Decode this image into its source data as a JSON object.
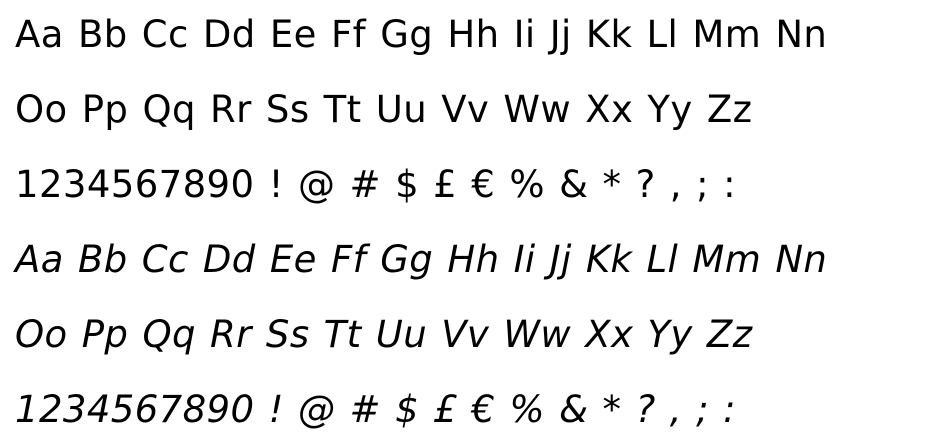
{
  "specimen": {
    "regular": {
      "line1": "Aa Bb Cc Dd Ee Ff Gg Hh Ii Jj Kk Ll Mm Nn",
      "line2": "Oo Pp Qq Rr Ss Tt Uu Vv Ww Xx Yy Zz",
      "line3": "1234567890 ! @ # $ £ € % & * ? , ; :"
    },
    "italic": {
      "line1": "Aa Bb Cc Dd Ee Ff Gg Hh Ii Jj Kk Ll Mm Nn",
      "line2": "Oo Pp Qq Rr Ss Tt Uu Vv Ww Xx Yy Zz",
      "line3": "1234567890 ! @ # $ £ € % & * ? , ; :"
    }
  }
}
